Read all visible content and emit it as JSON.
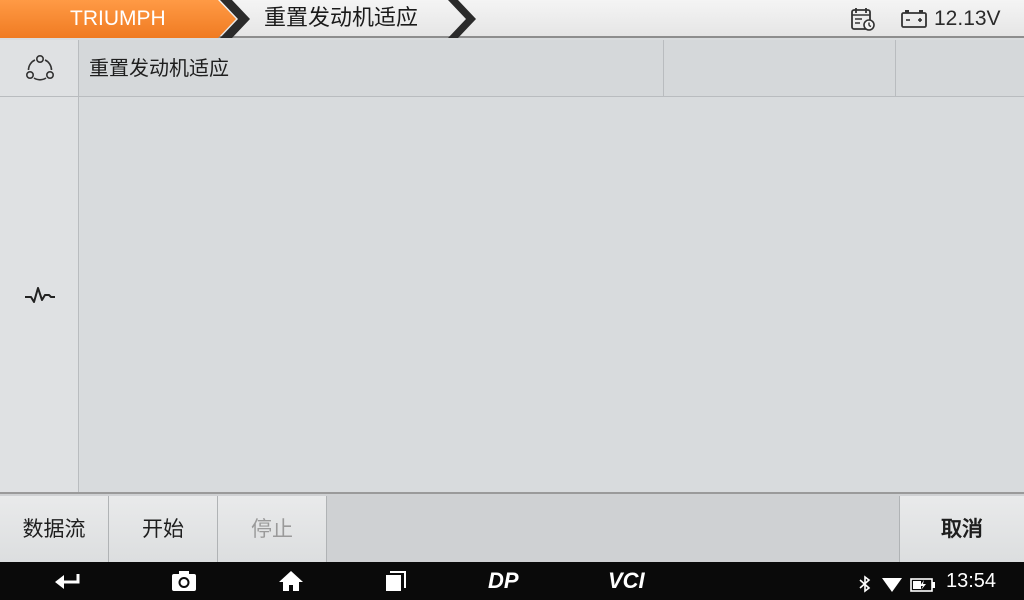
{
  "header": {
    "brand": "TRIUMPH",
    "page_title": "重置发动机适应",
    "voltage": "12.13V"
  },
  "table": {
    "title": "重置发动机适应"
  },
  "toolbar": {
    "datastream_label": "数据流",
    "start_label": "开始",
    "stop_label": "停止",
    "cancel_label": "取消"
  },
  "navbar": {
    "dp_label": "DP",
    "vci_label": "VCI",
    "clock": "13:54"
  },
  "colors": {
    "brand_orange": "#f07b22",
    "header_bg": "#eeeeee",
    "navbar_bg": "#0a0a0a"
  }
}
